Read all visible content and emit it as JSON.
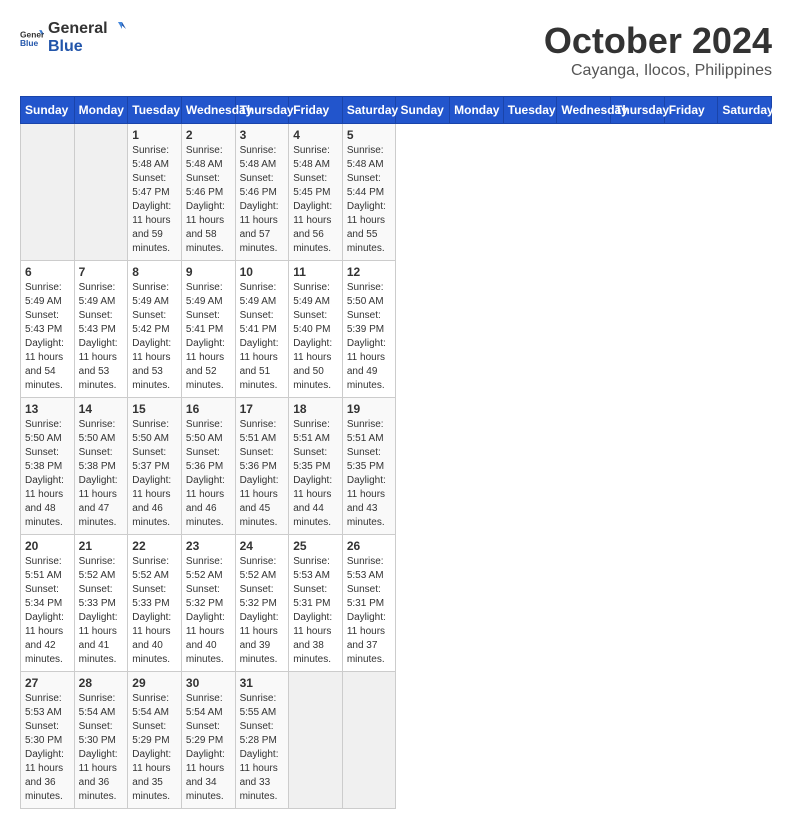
{
  "header": {
    "logo_general": "General",
    "logo_blue": "Blue",
    "month_year": "October 2024",
    "location": "Cayanga, Ilocos, Philippines"
  },
  "days_of_week": [
    "Sunday",
    "Monday",
    "Tuesday",
    "Wednesday",
    "Thursday",
    "Friday",
    "Saturday"
  ],
  "weeks": [
    [
      {
        "day": "",
        "info": ""
      },
      {
        "day": "",
        "info": ""
      },
      {
        "day": "1",
        "sunrise": "5:48 AM",
        "sunset": "5:47 PM",
        "daylight": "11 hours and 59 minutes."
      },
      {
        "day": "2",
        "sunrise": "5:48 AM",
        "sunset": "5:46 PM",
        "daylight": "11 hours and 58 minutes."
      },
      {
        "day": "3",
        "sunrise": "5:48 AM",
        "sunset": "5:46 PM",
        "daylight": "11 hours and 57 minutes."
      },
      {
        "day": "4",
        "sunrise": "5:48 AM",
        "sunset": "5:45 PM",
        "daylight": "11 hours and 56 minutes."
      },
      {
        "day": "5",
        "sunrise": "5:48 AM",
        "sunset": "5:44 PM",
        "daylight": "11 hours and 55 minutes."
      }
    ],
    [
      {
        "day": "6",
        "sunrise": "5:49 AM",
        "sunset": "5:43 PM",
        "daylight": "11 hours and 54 minutes."
      },
      {
        "day": "7",
        "sunrise": "5:49 AM",
        "sunset": "5:43 PM",
        "daylight": "11 hours and 53 minutes."
      },
      {
        "day": "8",
        "sunrise": "5:49 AM",
        "sunset": "5:42 PM",
        "daylight": "11 hours and 53 minutes."
      },
      {
        "day": "9",
        "sunrise": "5:49 AM",
        "sunset": "5:41 PM",
        "daylight": "11 hours and 52 minutes."
      },
      {
        "day": "10",
        "sunrise": "5:49 AM",
        "sunset": "5:41 PM",
        "daylight": "11 hours and 51 minutes."
      },
      {
        "day": "11",
        "sunrise": "5:49 AM",
        "sunset": "5:40 PM",
        "daylight": "11 hours and 50 minutes."
      },
      {
        "day": "12",
        "sunrise": "5:50 AM",
        "sunset": "5:39 PM",
        "daylight": "11 hours and 49 minutes."
      }
    ],
    [
      {
        "day": "13",
        "sunrise": "5:50 AM",
        "sunset": "5:38 PM",
        "daylight": "11 hours and 48 minutes."
      },
      {
        "day": "14",
        "sunrise": "5:50 AM",
        "sunset": "5:38 PM",
        "daylight": "11 hours and 47 minutes."
      },
      {
        "day": "15",
        "sunrise": "5:50 AM",
        "sunset": "5:37 PM",
        "daylight": "11 hours and 46 minutes."
      },
      {
        "day": "16",
        "sunrise": "5:50 AM",
        "sunset": "5:36 PM",
        "daylight": "11 hours and 46 minutes."
      },
      {
        "day": "17",
        "sunrise": "5:51 AM",
        "sunset": "5:36 PM",
        "daylight": "11 hours and 45 minutes."
      },
      {
        "day": "18",
        "sunrise": "5:51 AM",
        "sunset": "5:35 PM",
        "daylight": "11 hours and 44 minutes."
      },
      {
        "day": "19",
        "sunrise": "5:51 AM",
        "sunset": "5:35 PM",
        "daylight": "11 hours and 43 minutes."
      }
    ],
    [
      {
        "day": "20",
        "sunrise": "5:51 AM",
        "sunset": "5:34 PM",
        "daylight": "11 hours and 42 minutes."
      },
      {
        "day": "21",
        "sunrise": "5:52 AM",
        "sunset": "5:33 PM",
        "daylight": "11 hours and 41 minutes."
      },
      {
        "day": "22",
        "sunrise": "5:52 AM",
        "sunset": "5:33 PM",
        "daylight": "11 hours and 40 minutes."
      },
      {
        "day": "23",
        "sunrise": "5:52 AM",
        "sunset": "5:32 PM",
        "daylight": "11 hours and 40 minutes."
      },
      {
        "day": "24",
        "sunrise": "5:52 AM",
        "sunset": "5:32 PM",
        "daylight": "11 hours and 39 minutes."
      },
      {
        "day": "25",
        "sunrise": "5:53 AM",
        "sunset": "5:31 PM",
        "daylight": "11 hours and 38 minutes."
      },
      {
        "day": "26",
        "sunrise": "5:53 AM",
        "sunset": "5:31 PM",
        "daylight": "11 hours and 37 minutes."
      }
    ],
    [
      {
        "day": "27",
        "sunrise": "5:53 AM",
        "sunset": "5:30 PM",
        "daylight": "11 hours and 36 minutes."
      },
      {
        "day": "28",
        "sunrise": "5:54 AM",
        "sunset": "5:30 PM",
        "daylight": "11 hours and 36 minutes."
      },
      {
        "day": "29",
        "sunrise": "5:54 AM",
        "sunset": "5:29 PM",
        "daylight": "11 hours and 35 minutes."
      },
      {
        "day": "30",
        "sunrise": "5:54 AM",
        "sunset": "5:29 PM",
        "daylight": "11 hours and 34 minutes."
      },
      {
        "day": "31",
        "sunrise": "5:55 AM",
        "sunset": "5:28 PM",
        "daylight": "11 hours and 33 minutes."
      },
      {
        "day": "",
        "info": ""
      },
      {
        "day": "",
        "info": ""
      }
    ]
  ],
  "labels": {
    "sunrise": "Sunrise:",
    "sunset": "Sunset:",
    "daylight": "Daylight:"
  }
}
